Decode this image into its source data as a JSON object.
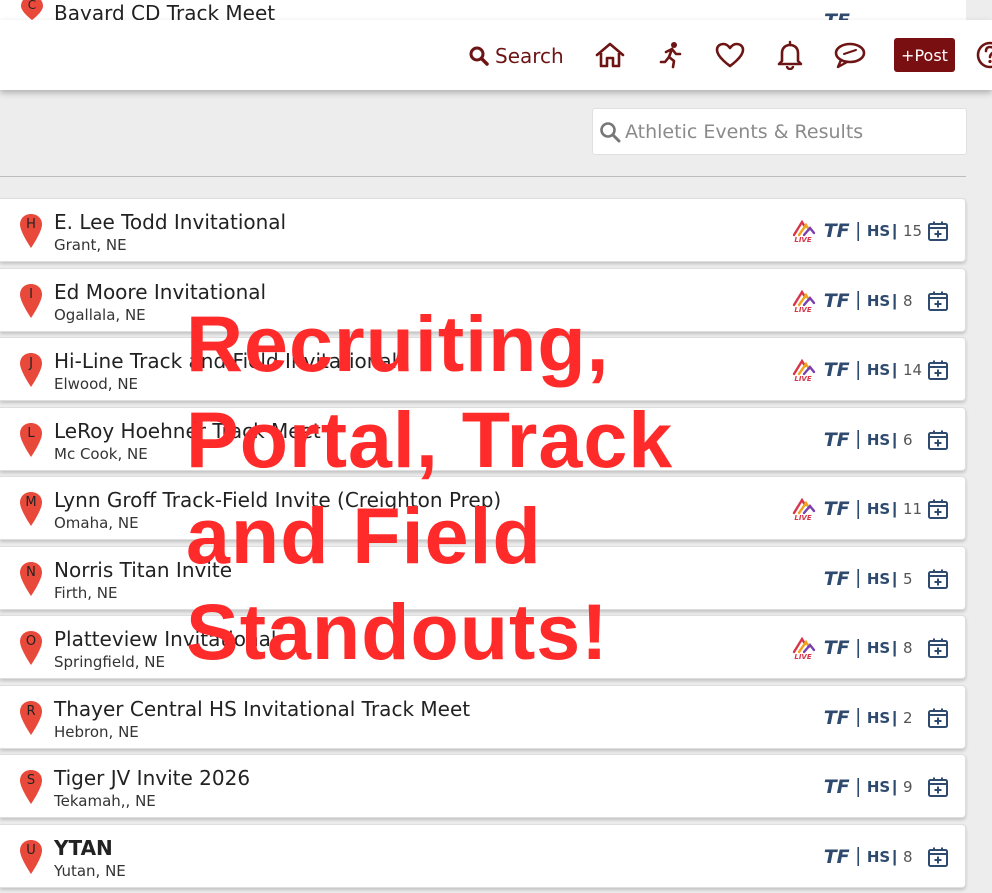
{
  "behind_row": {
    "pin_letter": "C",
    "name": "Bayard CD Track Meet",
    "sport": "TF"
  },
  "header": {
    "search_label": "Search",
    "post_label": "+Post",
    "icons": [
      "home-icon",
      "running-person-icon",
      "heart-icon",
      "bell-icon",
      "chat-icon",
      "help-icon"
    ]
  },
  "filter": {
    "placeholder": "Athletic Events & Results"
  },
  "events": [
    {
      "letter": "H",
      "name": "E. Lee Todd Invitational",
      "location": "Grant, NE",
      "live": true,
      "sport": "TF",
      "level": "HS",
      "count": "15",
      "bold": false
    },
    {
      "letter": "I",
      "name": "Ed Moore Invitational",
      "location": "Ogallala, NE",
      "live": true,
      "sport": "TF",
      "level": "HS",
      "count": "8",
      "bold": false
    },
    {
      "letter": "J",
      "name": "Hi-Line Track and Field Invitational",
      "location": "Elwood, NE",
      "live": true,
      "sport": "TF",
      "level": "HS",
      "count": "14",
      "bold": false
    },
    {
      "letter": "L",
      "name": "LeRoy Hoehner Track Meet",
      "location": "Mc Cook, NE",
      "live": false,
      "sport": "TF",
      "level": "HS",
      "count": "6",
      "bold": false
    },
    {
      "letter": "M",
      "name": "Lynn Groff Track-Field Invite (Creighton Prep)",
      "location": "Omaha, NE",
      "live": true,
      "sport": "TF",
      "level": "HS",
      "count": "11",
      "bold": false
    },
    {
      "letter": "N",
      "name": "Norris Titan Invite",
      "location": "Firth, NE",
      "live": false,
      "sport": "TF",
      "level": "HS",
      "count": "5",
      "bold": false
    },
    {
      "letter": "O",
      "name": "Platteview Invitational",
      "location": "Springfield, NE",
      "live": true,
      "sport": "TF",
      "level": "HS",
      "count": "8",
      "bold": false
    },
    {
      "letter": "R",
      "name": "Thayer Central HS Invitational Track Meet",
      "location": "Hebron, NE",
      "live": false,
      "sport": "TF",
      "level": "HS",
      "count": "2",
      "bold": false
    },
    {
      "letter": "S",
      "name": "Tiger JV Invite 2026",
      "location": "Tekamah,, NE",
      "live": false,
      "sport": "TF",
      "level": "HS",
      "count": "9",
      "bold": false
    },
    {
      "letter": "U",
      "name": "YTAN",
      "location": "Yutan, NE",
      "live": false,
      "sport": "TF",
      "level": "HS",
      "count": "8",
      "bold": true
    }
  ],
  "overlay": {
    "lines": [
      "Recruiting,",
      "Portal, Track",
      "and Field",
      "Standouts!"
    ]
  },
  "colors": {
    "brand": "#7a0f12",
    "pin": "#e8493a",
    "meta": "#2e4a6e",
    "overlay": "#ff2b2b"
  }
}
